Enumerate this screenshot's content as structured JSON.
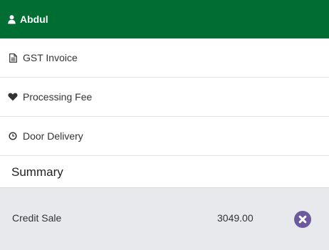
{
  "customer": {
    "name": "Abdul",
    "icon": "user-icon"
  },
  "options": [
    {
      "label": "GST Invoice",
      "icon": "document-icon"
    },
    {
      "label": "Processing Fee",
      "icon": "heart-icon"
    },
    {
      "label": "Door Delivery",
      "icon": "clock-icon"
    }
  ],
  "summary": {
    "title": "Summary",
    "lines": [
      {
        "label": "Credit Sale",
        "amount": "3049.00",
        "remove_icon": "close-circle-icon"
      }
    ]
  },
  "colors": {
    "header_bg": "#006e32",
    "summary_bg": "#e7e9ed",
    "remove_button": "#6c5b9c"
  }
}
